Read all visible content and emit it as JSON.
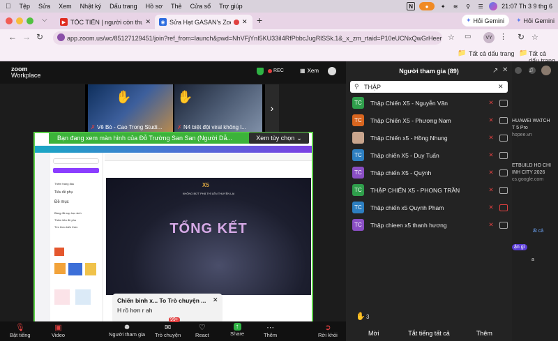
{
  "menubar": {
    "items": [
      "Tệp",
      "Sửa",
      "Xem",
      "Nhật ký",
      "Dấu trang",
      "Hồ sơ",
      "Thẻ",
      "Cửa sổ",
      "Trợ giúp"
    ],
    "clock": "21:07 Th 3 9 thg 6"
  },
  "tabs": {
    "tab1_title": "TỐC TIẾN | người còn thường...",
    "tab2_title": "Sửa Hạt GASAN's Zoom M...",
    "new_tab": "+",
    "gemini_label": "Hỏi Gemini",
    "gemini_label_right": "Hỏi Gemini"
  },
  "address": {
    "url": "app.zoom.us/wc/85127129451/join?ref_from=launch&pwd=NhVFjYnI5KU33iI4RfPbbcJugRlSSk.1&_x_zm_rtaid=P10eUCNxQwGrHeerVsF5VA...",
    "profile": "VY",
    "bookmarks_label": "Tất cả dấu trang",
    "bookmarks_label_right": "Tất cả dấu trang"
  },
  "zoom": {
    "logo_top": "zoom",
    "logo_bottom": "Workplace",
    "rec": "REC",
    "view": "Xem",
    "thumbs": [
      {
        "caption": "Vẽ Bò - Cao Trong Studi..."
      },
      {
        "caption": "N4 biệt đội viral không l..."
      }
    ],
    "share_banner": "Bạn đang xem màn hình của  Đỗ Trường San San (Người Dẫ...",
    "view_options": "Xem tùy chọn",
    "slide": {
      "brand": "X5",
      "tagline": "KHÔNG BỨT PHÁ THÌ LÊN THUYỀN LẠI",
      "heading": "TỔNG KẾT"
    },
    "canva_sidebar": [
      "Thêm trang đầu",
      "Tiêu đề phụ",
      "Đề mục",
      "Bảng đã nạp học sinh",
      "Thêm tiêu đề phụ",
      "Tìm theo kiến thức"
    ],
    "notification": {
      "title": "Chiến binh x... To Trò chuyện ...",
      "message": "H rồ hơn r ah"
    }
  },
  "toolbar": {
    "items": [
      "Bật tiếng",
      "Video",
      "Người tham gia",
      "Trò chuyện",
      "React",
      "Share",
      "Thêm",
      "Rời khỏi"
    ],
    "participant_count": "89",
    "chat_badge": "99+"
  },
  "panel": {
    "title": "Người tham gia (89)",
    "search_value": "THẬP",
    "participants": [
      {
        "initials": "TC",
        "name": "Thập Chiến X5 - Nguyễn Văn",
        "color": "#2f9e4b"
      },
      {
        "initials": "TC",
        "name": "Thập Chiến X5 - Phương Nam",
        "color": "#d9661f"
      },
      {
        "initials": "",
        "name": "Thập Chiến x5 - Hồng Nhung",
        "color": "#c9a58d"
      },
      {
        "initials": "TC",
        "name": "Thập chiến X5 - Duy Tuấn",
        "color": "#2d7fc1"
      },
      {
        "initials": "TC",
        "name": "Thập chiến X5 - Quỳnh",
        "color": "#8a4fc4"
      },
      {
        "initials": "TC",
        "name": "THẬP CHIẾN X5 - PHONG TRẦN",
        "color": "#2f9e4b"
      },
      {
        "initials": "TC",
        "name": "Thập chiến x5 Quynh Pham",
        "color": "#2d7fc1"
      },
      {
        "initials": "TC",
        "name": "Thập chieen x5 thanh hương",
        "color": "#8a4fc4"
      }
    ],
    "raised_hands": "3",
    "buttons": [
      "Mời",
      "Tắt tiếng tất cả",
      "Thêm"
    ]
  },
  "rightpage": {
    "texts": [
      "HUAWEI WATCH",
      "T 5 Pro",
      "hopee.vn",
      "ETBUILD HO CHI",
      "INH CITY 2026",
      "cs.google.com",
      "ất cả",
      "ận gì",
      "a"
    ]
  },
  "colors": {
    "share_border": "#5fd34b",
    "rec_red": "#e04040",
    "panel_bg": "#232323"
  }
}
